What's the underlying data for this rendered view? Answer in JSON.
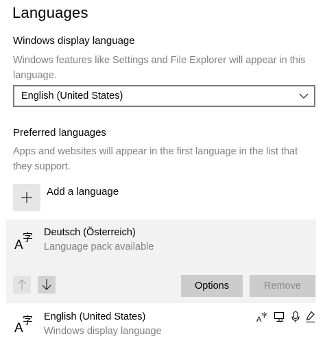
{
  "page": {
    "title": "Languages"
  },
  "display_language": {
    "heading": "Windows display language",
    "description": "Windows features like Settings and File Explorer will appear in this language.",
    "selected_value": "English (United States)"
  },
  "preferred_languages": {
    "heading": "Preferred languages",
    "description": "Apps and websites will appear in the first language in the list that they support.",
    "add_label": "Add a language",
    "items": [
      {
        "name": "Deutsch (Österreich)",
        "status": "Language pack available",
        "icon": "language-icon",
        "selected": true,
        "options_label": "Options",
        "remove_label": "Remove"
      },
      {
        "name": "English (United States)",
        "status": "Windows display language",
        "icon": "language-icon",
        "feature_icons": [
          "text-input-icon",
          "display-language-icon",
          "speech-icon",
          "handwriting-icon"
        ]
      }
    ]
  },
  "colors": {
    "selected_row_bg": "#f2f2f2",
    "button_bg": "#cccccc",
    "secondary_text": "#808080"
  }
}
